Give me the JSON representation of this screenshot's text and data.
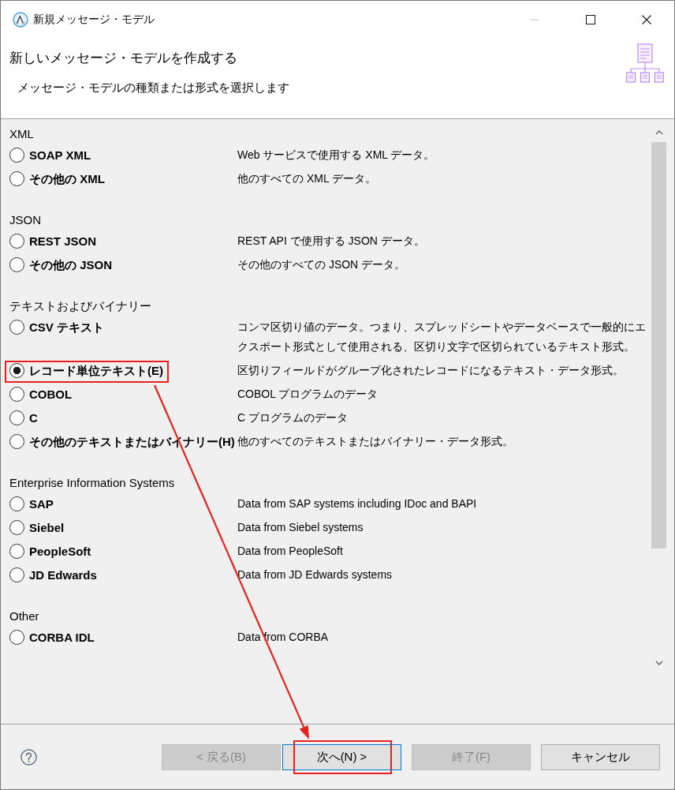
{
  "window": {
    "title": "新規メッセージ・モデル",
    "controls": [
      {
        "kind": "minimize",
        "disabled": true
      },
      {
        "kind": "maximize",
        "disabled": false
      },
      {
        "kind": "close",
        "disabled": false
      }
    ]
  },
  "header": {
    "title": "新しいメッセージ・モデルを作成する",
    "description": "メッセージ・モデルの種類または形式を選択します"
  },
  "groups": [
    {
      "title": "XML",
      "options": [
        {
          "label": "SOAP XML",
          "description": "Web サービスで使用する XML データ。",
          "selected": false,
          "highlighted": false
        },
        {
          "label": "その他の XML",
          "description": "他のすべての XML データ。",
          "selected": false,
          "highlighted": false
        }
      ]
    },
    {
      "title": "JSON",
      "options": [
        {
          "label": "REST JSON",
          "description": "REST API で使用する JSON データ。",
          "selected": false,
          "highlighted": false
        },
        {
          "label": "その他の JSON",
          "description": "その他のすべての JSON データ。",
          "selected": false,
          "highlighted": false
        }
      ]
    },
    {
      "title": "テキストおよびバイナリー",
      "options": [
        {
          "label": "CSV テキスト",
          "description": "コンマ区切り値のデータ。つまり、スプレッドシートやデータベースで一般的にエクスポート形式として使用される、区切り文字で区切られているテキスト形式。",
          "selected": false,
          "highlighted": false
        },
        {
          "label": "レコード単位テキスト(E)",
          "description": "区切りフィールドがグループ化されたレコードになるテキスト・データ形式。",
          "selected": true,
          "highlighted": true
        },
        {
          "label": "COBOL",
          "description": "COBOL プログラムのデータ",
          "selected": false,
          "highlighted": false
        },
        {
          "label": "C",
          "description": "C プログラムのデータ",
          "selected": false,
          "highlighted": false
        },
        {
          "label": "その他のテキストまたはバイナリー(H)",
          "description": "他のすべてのテキストまたはバイナリー・データ形式。",
          "selected": false,
          "highlighted": false
        }
      ]
    },
    {
      "title": "Enterprise Information Systems",
      "options": [
        {
          "label": "SAP",
          "description": "Data from SAP systems including IDoc and BAPI",
          "selected": false,
          "highlighted": false
        },
        {
          "label": "Siebel",
          "description": "Data from Siebel systems",
          "selected": false,
          "highlighted": false
        },
        {
          "label": "PeopleSoft",
          "description": "Data from PeopleSoft",
          "selected": false,
          "highlighted": false
        },
        {
          "label": "JD Edwards",
          "description": "Data from JD Edwards systems",
          "selected": false,
          "highlighted": false
        }
      ]
    },
    {
      "title": "Other",
      "options": [
        {
          "label": "CORBA IDL",
          "description": "Data from CORBA",
          "selected": false,
          "highlighted": false
        }
      ]
    }
  ],
  "buttons": [
    {
      "label": "< 戻る(B)",
      "disabled": true,
      "focused": false,
      "highlighted": false
    },
    {
      "label": "次へ(N) >",
      "disabled": false,
      "focused": true,
      "highlighted": true
    },
    {
      "label": "終了(F)",
      "disabled": true,
      "focused": false,
      "highlighted": false
    },
    {
      "label": "キャンセル",
      "disabled": false,
      "focused": false,
      "highlighted": false
    }
  ]
}
